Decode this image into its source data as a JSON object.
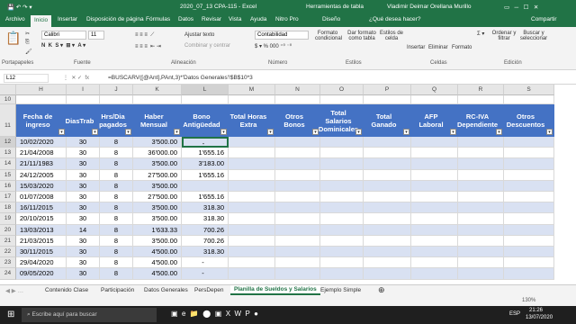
{
  "title": {
    "left": "2020_07_13 CPA-115  -  Excel",
    "mid": "Herramientas de tabla",
    "user": "Vladimir Deimar Orellana Murillo"
  },
  "menu": [
    "Archivo",
    "Inicio",
    "Insertar",
    "Disposición de página",
    "Fórmulas",
    "Datos",
    "Revisar",
    "Vista",
    "Ayuda",
    "Nitro Pro",
    "Diseño",
    "¿Qué desea hacer?",
    "Compartir"
  ],
  "ribbon": {
    "font": "Calibri",
    "size": "11",
    "wrap": "Ajustar texto",
    "merge": "Combinar y centrar",
    "format": "Contabilidad",
    "cond": "Formato condicional",
    "astable": "Dar formato como tabla",
    "styles": "Estilos de celda",
    "insert": "Insertar",
    "delete": "Eliminar",
    "fmt": "Formato",
    "sort": "Ordenar y filtrar",
    "find": "Buscar y seleccionar",
    "g1": "Portapapeles",
    "g2": "Fuente",
    "g3": "Alineación",
    "g4": "Número",
    "g5": "Estilos",
    "g6": "Celdas",
    "g7": "Edición"
  },
  "namebox": "L12",
  "formula": "=BUSCARV([@Ant],PAnt,3)*'Datos Generales'!$B$10*3",
  "cols": [
    "H",
    "I",
    "J",
    "K",
    "L",
    "M",
    "N",
    "O",
    "P",
    "Q",
    "R",
    "S"
  ],
  "headers": [
    "Fecha de ingreso",
    "DiasTrab",
    "Hrs/Dia pagados",
    "Haber Mensual",
    "Bono Antigüedad",
    "Total Horas Extra",
    "Otros Bonos",
    "Total Salarios Dominicales",
    "Total Ganado",
    "AFP Laboral",
    "RC-IVA Dependiente",
    "Otros Descuentos"
  ],
  "rownums": [
    "10",
    "11",
    "12",
    "13",
    "14",
    "15",
    "16",
    "17",
    "18",
    "19",
    "20",
    "21",
    "22",
    "23",
    "24",
    "25"
  ],
  "rows": [
    [
      "10/02/2020",
      "30",
      "8",
      "3'500.00",
      "-"
    ],
    [
      "21/04/2008",
      "30",
      "8",
      "36'000.00",
      "1'655.16"
    ],
    [
      "21/11/1983",
      "30",
      "8",
      "3'500.00",
      "3'183.00"
    ],
    [
      "24/12/2005",
      "30",
      "8",
      "27'500.00",
      "1'655.16"
    ],
    [
      "15/03/2020",
      "30",
      "8",
      "3'500.00",
      ""
    ],
    [
      "01/07/2008",
      "30",
      "8",
      "27'500.00",
      "1'655.16"
    ],
    [
      "16/11/2015",
      "30",
      "8",
      "3'500.00",
      "318.30"
    ],
    [
      "20/10/2015",
      "30",
      "8",
      "3'500.00",
      "318.30"
    ],
    [
      "13/03/2013",
      "14",
      "8",
      "1'633.33",
      "700.26"
    ],
    [
      "21/03/2015",
      "30",
      "8",
      "3'500.00",
      "700.26"
    ],
    [
      "30/11/2015",
      "30",
      "8",
      "4'500.00",
      "318.30"
    ],
    [
      "29/04/2020",
      "30",
      "8",
      "4'500.00",
      "-"
    ],
    [
      "09/05/2020",
      "30",
      "8",
      "4'500.00",
      "-"
    ]
  ],
  "sheets": [
    "Contenido Clase",
    "Participación",
    "Datos Generales",
    "PersDepen",
    "Planilla de Sueldos y Salarios",
    "Ejemplo Simple"
  ],
  "status": {
    "zoom": "130%",
    "lang": "ESP",
    "time": "21:26",
    "date": "13/07/2020"
  },
  "search": "Escribe aquí para buscar"
}
